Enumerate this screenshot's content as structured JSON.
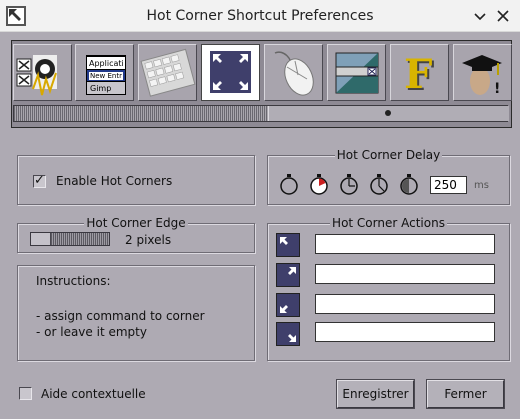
{
  "window": {
    "title": "Hot Corner Shortcut Preferences",
    "app_icon": "hot-corner-app-icon",
    "controls": [
      "minimize-icon",
      "close-icon"
    ]
  },
  "toolbar": {
    "icons": [
      {
        "name": "tool-mixer-icon",
        "text": ""
      },
      {
        "name": "tool-menu-editor-icon",
        "lines": [
          "Applicati",
          "New Entr",
          "Gimp"
        ]
      },
      {
        "name": "tool-keyboard-icon"
      },
      {
        "name": "tool-hot-corner-icon",
        "active": true
      },
      {
        "name": "tool-mouse-icon"
      },
      {
        "name": "tool-window-icon"
      },
      {
        "name": "tool-font-icon",
        "text": "F"
      },
      {
        "name": "tool-tutorial-icon"
      }
    ]
  },
  "enable": {
    "label": "Enable Hot Corners",
    "checked": true
  },
  "delay": {
    "title": "Hot Corner Delay",
    "value": "250",
    "unit": "ms"
  },
  "edge": {
    "title": "Hot Corner Edge",
    "value_label": "2 pixels"
  },
  "instructions": {
    "title": "Instructions:",
    "line1": "- assign command to corner",
    "line2": "- or leave it empty"
  },
  "actions": {
    "title": "Hot Corner Actions",
    "corners": [
      {
        "name": "top-left-corner-icon",
        "value": ""
      },
      {
        "name": "top-right-corner-icon",
        "value": ""
      },
      {
        "name": "bottom-left-corner-icon",
        "value": ""
      },
      {
        "name": "bottom-right-corner-icon",
        "value": ""
      }
    ]
  },
  "footer": {
    "help_label": "Aide contextuelle",
    "save_label": "Enregistrer",
    "close_label": "Fermer"
  },
  "colors": {
    "background": "#aeaab3",
    "corner_icon": "#3f3f6b",
    "stopwatch_accent": "#cc2020"
  }
}
